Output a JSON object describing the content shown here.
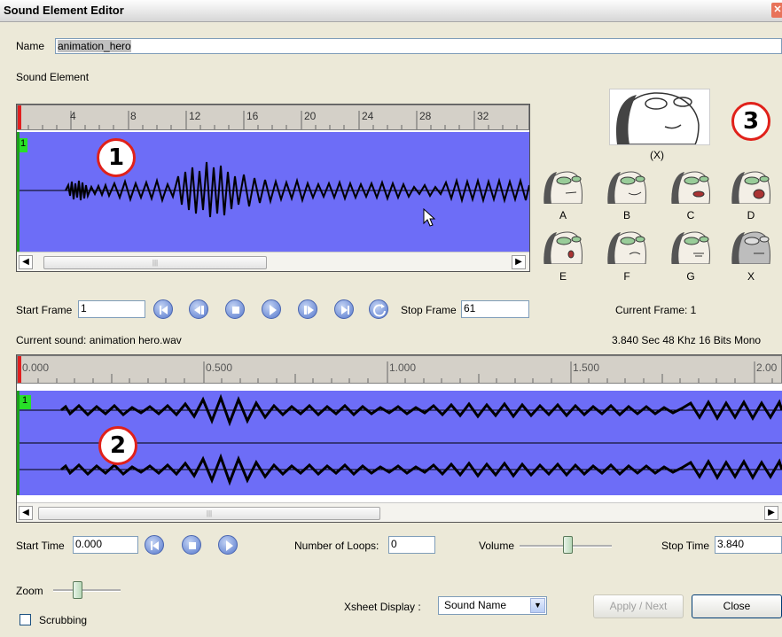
{
  "window": {
    "title": "Sound Element Editor"
  },
  "name_field": {
    "label": "Name",
    "value": "animation_hero"
  },
  "sound_element": {
    "label": "Sound Element",
    "ruler_ticks": [
      "4",
      "8",
      "12",
      "16",
      "20",
      "24",
      "28",
      "32"
    ],
    "frame_marker": "1",
    "badge": "1"
  },
  "lip_sync": {
    "badge": "3",
    "big_label": "(X)",
    "mouths_row1": [
      "A",
      "B",
      "C",
      "D"
    ],
    "mouths_row2": [
      "E",
      "F",
      "G",
      "X"
    ]
  },
  "frame_controls": {
    "start_label": "Start Frame",
    "start_value": "1",
    "stop_label": "Stop Frame",
    "stop_value": "61",
    "current_frame": "Current Frame: 1"
  },
  "sound_info": {
    "current_sound": "Current sound: animation hero.wav",
    "details": "3.840 Sec 48 Khz 16  Bits Mono"
  },
  "timeline": {
    "ruler_ticks": [
      "0.000",
      "0.500",
      "1.000",
      "1.500",
      "2.00"
    ],
    "frame_marker": "1",
    "badge": "2"
  },
  "time_controls": {
    "start_label": "Start Time",
    "start_value": "0.000",
    "loops_label": "Number of Loops:",
    "loops_value": "0",
    "volume_label": "Volume",
    "stop_label": "Stop Time",
    "stop_value": "3.840"
  },
  "zoom": {
    "label": "Zoom"
  },
  "scrubbing": {
    "label": "Scrubbing",
    "checked": false
  },
  "xsheet": {
    "label": "Xsheet Display :",
    "value": "Sound Name"
  },
  "buttons": {
    "apply_next": "Apply / Next",
    "close": "Close"
  }
}
